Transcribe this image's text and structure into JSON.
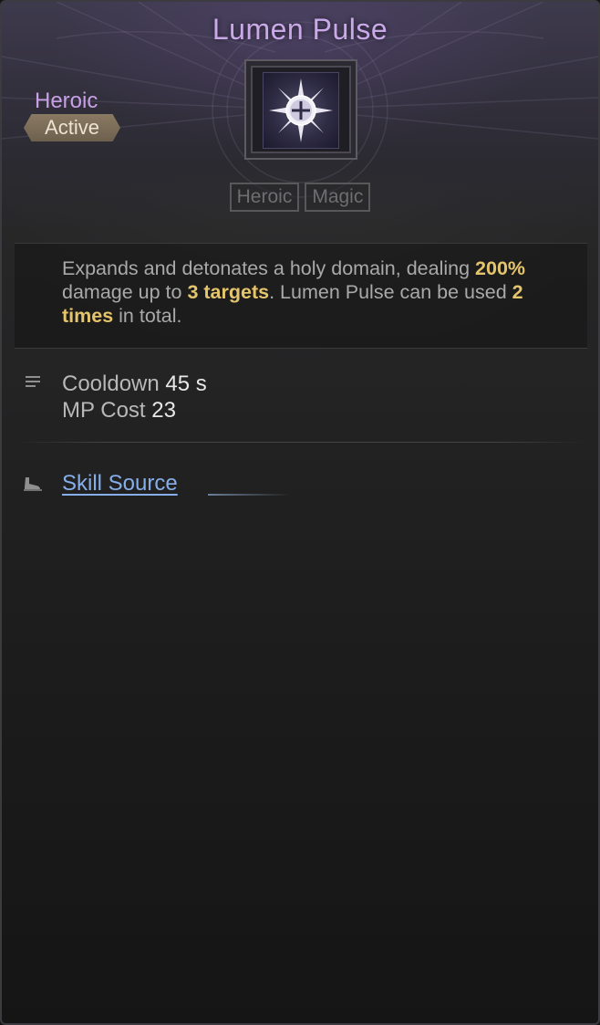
{
  "skill": {
    "name": "Lumen Pulse",
    "grade": "Heroic",
    "type": "Active",
    "icon": "holy-compass-burst-icon",
    "tags": [
      "Heroic",
      "Magic"
    ]
  },
  "description": {
    "p1": "Expands and detonates a holy domain, dealing ",
    "damage": "200%",
    "p2": " damage up to ",
    "targets": "3 targets",
    "p3": ". Lumen Pulse can be used ",
    "uses": "2 times",
    "p4": " in total."
  },
  "stats": {
    "cooldown_label": "Cooldown",
    "cooldown_value": "45 s",
    "mp_label": "MP Cost",
    "mp_value": "23"
  },
  "source": {
    "label": "Skill Source"
  },
  "colors": {
    "title": "#c9a9e8",
    "highlight": "#e5c56c",
    "link": "#86aee8"
  }
}
